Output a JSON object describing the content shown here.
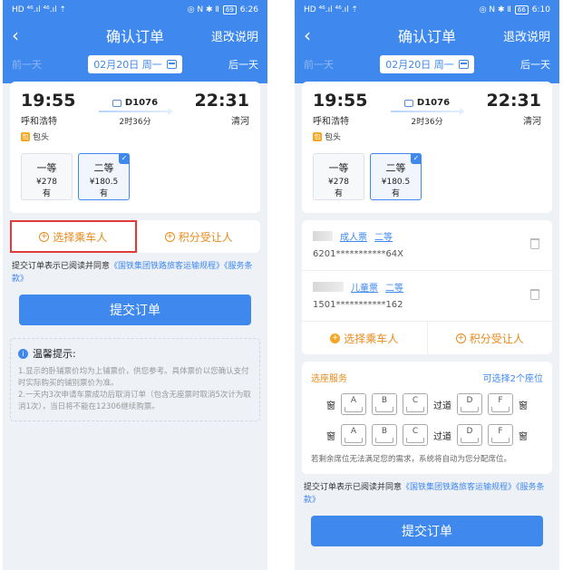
{
  "left": {
    "status": {
      "left": "HD ⁴⁶.ıl ⁴⁶.ıl ⇡",
      "right": "◎ N ✱ Ⅱ",
      "battery": "69",
      "time": "6:26"
    },
    "nav": {
      "back": "‹",
      "title": "确认订单",
      "refund": "退改说明"
    },
    "date": {
      "prev": "前一天",
      "value": "02月20日 周一",
      "next": "后一天"
    },
    "train": {
      "depart_time": "19:55",
      "depart_station": "呼和浩特",
      "via_badge": "包",
      "via": "包头",
      "train_no": "D1076",
      "duration": "2时36分",
      "arrive_time": "22:31",
      "arrive_station": "清河"
    },
    "seats": [
      {
        "name": "一等",
        "price": "¥278",
        "avail": "有"
      },
      {
        "name": "二等",
        "price": "¥180.5",
        "avail": "有"
      }
    ],
    "actions": {
      "select_passenger": "选择乘车人",
      "points_transfer": "积分受让人"
    },
    "agree": {
      "prefix": "提交订单表示已阅读并同意",
      "link1": "《国铁集团铁路旅客运输规程》",
      "link2": "《服务条款》"
    },
    "submit": "提交订单",
    "tips": {
      "title": "温馨提示:",
      "items": [
        "1.显示的卧铺票价均为上铺票价，供您参考。具体票价以您确认支付时实际购买的铺别票价为准。",
        "2.一天内3次申请车票成功后取消订单（包含无座票时取消5次计为取消1次），当日将不能在12306继续购票。"
      ]
    }
  },
  "right": {
    "status": {
      "left": "HD ⁴⁶.ıl ⁴⁶.ıl ⇡",
      "right": "◎ N ✱ Ⅱ",
      "battery": "66",
      "time": "6:10"
    },
    "nav": {
      "back": "‹",
      "title": "确认订单",
      "refund": "退改说明"
    },
    "date": {
      "prev": "前一天",
      "value": "02月20日 周一",
      "next": "后一天"
    },
    "train": {
      "depart_time": "19:55",
      "depart_station": "呼和浩特",
      "via_badge": "包",
      "via": "包头",
      "train_no": "D1076",
      "duration": "2时36分",
      "arrive_time": "22:31",
      "arrive_station": "清河"
    },
    "seats": [
      {
        "name": "一等",
        "price": "¥278",
        "avail": "有"
      },
      {
        "name": "二等",
        "price": "¥180.5",
        "avail": "有"
      }
    ],
    "passengers": [
      {
        "ticket_type": "成人票",
        "seat_class": "二等",
        "id": "6201***********64X"
      },
      {
        "ticket_type": "儿童票",
        "seat_class": "二等",
        "id": "1501***********162"
      }
    ],
    "actions": {
      "select_passenger": "选择乘车人",
      "points_transfer": "积分受让人"
    },
    "service": {
      "title": "选座服务",
      "hint": "可选择2个座位",
      "window": "窗",
      "aisle": "过道",
      "letters": [
        "A",
        "B",
        "C",
        "D",
        "F"
      ],
      "note": "若剩余席位无法满足您的需求，系统将自动为您分配席位。"
    },
    "agree": {
      "prefix": "提交订单表示已阅读并同意",
      "link1": "《国铁集团铁路旅客运输规程》",
      "link2": "《服务条款》"
    },
    "submit": "提交订单"
  },
  "colors": {
    "primary": "#3f88ee",
    "accent": "#e88a1a",
    "highlight": "#e23b3b"
  }
}
